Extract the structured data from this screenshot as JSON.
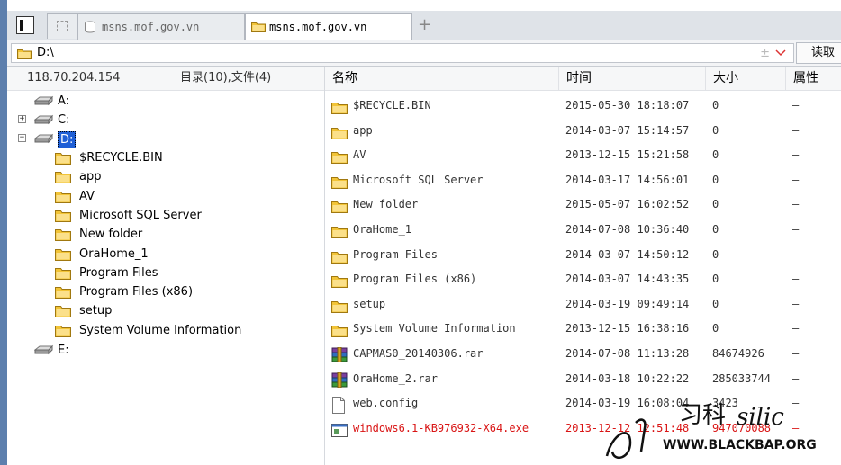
{
  "tabs": [
    {
      "label": "msns.mof.gov.vn",
      "active": false
    },
    {
      "label": "msns.mof.gov.vn",
      "active": true
    }
  ],
  "tab_add_label": "+",
  "address": {
    "value": "D:\\",
    "plus_minus": "±",
    "read_button": "读取"
  },
  "left_panel": {
    "ip": "118.70.204.154",
    "counts": "目录(10),文件(4)",
    "drives": [
      {
        "label": "A:",
        "expander": ""
      },
      {
        "label": "C:",
        "expander": "+"
      },
      {
        "label": "D:",
        "expander": "−",
        "selected": true
      },
      {
        "label": "E:",
        "expander": ""
      }
    ],
    "folders": [
      "$RECYCLE.BIN",
      "app",
      "AV",
      "Microsoft SQL Server",
      "New folder",
      "OraHome_1",
      "Program Files",
      "Program Files (x86)",
      "setup",
      "System Volume Information"
    ]
  },
  "columns": {
    "name": "名称",
    "time": "时间",
    "size": "大小",
    "attr": "属性"
  },
  "files": [
    {
      "name": "$RECYCLE.BIN",
      "time": "2015-05-30 18:18:07",
      "size": "0",
      "attr": "–",
      "icon": "folder-icon"
    },
    {
      "name": "app",
      "time": "2014-03-07 15:14:57",
      "size": "0",
      "attr": "–",
      "icon": "folder-icon"
    },
    {
      "name": "AV",
      "time": "2013-12-15 15:21:58",
      "size": "0",
      "attr": "–",
      "icon": "folder-icon"
    },
    {
      "name": "Microsoft SQL Server",
      "time": "2014-03-17 14:56:01",
      "size": "0",
      "attr": "–",
      "icon": "folder-icon"
    },
    {
      "name": "New folder",
      "time": "2015-05-07 16:02:52",
      "size": "0",
      "attr": "–",
      "icon": "folder-icon"
    },
    {
      "name": "OraHome_1",
      "time": "2014-07-08 10:36:40",
      "size": "0",
      "attr": "–",
      "icon": "folder-icon"
    },
    {
      "name": "Program Files",
      "time": "2014-03-07 14:50:12",
      "size": "0",
      "attr": "–",
      "icon": "folder-icon"
    },
    {
      "name": "Program Files (x86)",
      "time": "2014-03-07 14:43:35",
      "size": "0",
      "attr": "–",
      "icon": "folder-icon"
    },
    {
      "name": "setup",
      "time": "2014-03-19 09:49:14",
      "size": "0",
      "attr": "–",
      "icon": "folder-icon"
    },
    {
      "name": "System Volume Information",
      "time": "2013-12-15 16:38:16",
      "size": "0",
      "attr": "–",
      "icon": "folder-icon"
    },
    {
      "name": "CAPMAS0_20140306.rar",
      "time": "2014-07-08 11:13:28",
      "size": "84674926",
      "attr": "–",
      "icon": "rar-icon"
    },
    {
      "name": "OraHome_2.rar",
      "time": "2014-03-18 10:22:22",
      "size": "285033744",
      "attr": "–",
      "icon": "rar-icon"
    },
    {
      "name": "web.config",
      "time": "2014-03-19 16:08:04",
      "size": "3423",
      "attr": "–",
      "icon": "file-icon"
    },
    {
      "name": "windows6.1-KB976932-X64.exe",
      "time": "2013-12-12 12:51:48",
      "size": "947070088",
      "attr": "–",
      "icon": "exe-icon",
      "highlight": true
    }
  ],
  "watermark": {
    "chinese": "习科",
    "script": "silic",
    "url": "WWW.BLACKBAP.ORG"
  },
  "colors": {
    "folder": "#f2c437",
    "selection": "#1f5fd6",
    "highlight_text": "#d91414",
    "frame": "#5d7fad"
  }
}
